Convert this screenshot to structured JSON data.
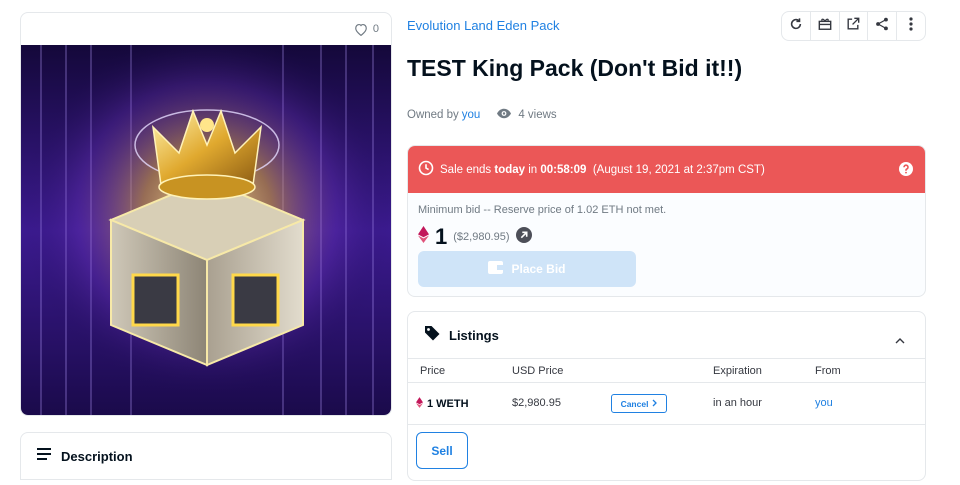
{
  "favorites": {
    "count": "0"
  },
  "collection": {
    "name": "Evolution Land Eden Pack"
  },
  "item": {
    "title": "TEST King Pack (Don't Bid it!!)",
    "owned_by_label": "Owned by",
    "owner": "you",
    "views": "4 views"
  },
  "toolbar": {
    "icons": [
      "refresh-icon",
      "transfer-icon",
      "external-link-icon",
      "share-icon",
      "more-icon"
    ]
  },
  "sale": {
    "prefix": "Sale ends",
    "emphasis": "today",
    "in_label": "in",
    "countdown": "00:58:09",
    "date": "(August 19, 2021 at 2:37pm CST)",
    "min_bid_text": "Minimum bid -- Reserve price of 1.02 ETH not met.",
    "price": "1",
    "price_usd": "($2,980.95)",
    "place_bid_label": "Place Bid",
    "banner_color": "#eb5757"
  },
  "listings": {
    "title": "Listings",
    "columns": [
      "Price",
      "USD Price",
      "Expiration",
      "From"
    ],
    "rows": [
      {
        "price": "1 WETH",
        "usd_price": "$2,980.95",
        "action": "Cancel",
        "expiration": "in an hour",
        "from": "you"
      }
    ],
    "sell_label": "Sell"
  },
  "description": {
    "title": "Description"
  },
  "colors": {
    "accent": "#2081e2",
    "text": "#04111d",
    "muted": "#707a83"
  }
}
